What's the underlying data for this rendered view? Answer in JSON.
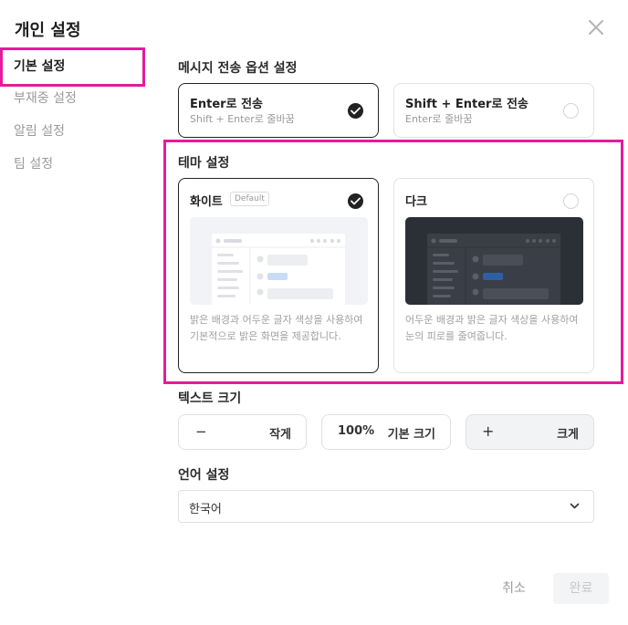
{
  "dialog": {
    "title": "개인 설정"
  },
  "sidebar": {
    "items": [
      {
        "label": "기본 설정"
      },
      {
        "label": "부재중 설정"
      },
      {
        "label": "알림 설정"
      },
      {
        "label": "팀 설정"
      }
    ]
  },
  "send_options": {
    "label": "메시지 전송 옵션 설정",
    "options": [
      {
        "title": "Enter로 전송",
        "sub": "Shift + Enter로 줄바꿈",
        "selected": true
      },
      {
        "title": "Shift + Enter로 전송",
        "sub": "Enter로 줄바꿈",
        "selected": false
      }
    ]
  },
  "theme": {
    "label": "테마 설정",
    "options": [
      {
        "title": "화이트",
        "badge": "Default",
        "desc": "밝은 배경과 어두운 글자 색상을 사용하여 기본적으로 밝은 화면을 제공합니다.",
        "selected": true
      },
      {
        "title": "다크",
        "desc": "어두운 배경과 밝은 글자 색상을 사용하여 눈의 피로를 줄여줍니다.",
        "selected": false
      }
    ]
  },
  "text_size": {
    "label": "텍스트 크기",
    "decrease_label": "작게",
    "decrease_symbol": "−",
    "current_value": "100%",
    "current_label": "기본 크기",
    "increase_label": "크게",
    "increase_symbol": "+"
  },
  "language": {
    "label": "언어 설정",
    "selected": "한국어"
  },
  "footer": {
    "cancel_label": "취소",
    "done_label": "완료"
  },
  "colors": {
    "highlight": "#e51a9b",
    "selected_border": "#222222",
    "dark_preview": "#2b2f36"
  },
  "icons": {
    "close": "close-icon",
    "check": "check-icon",
    "chevron": "chevron-down-icon"
  }
}
